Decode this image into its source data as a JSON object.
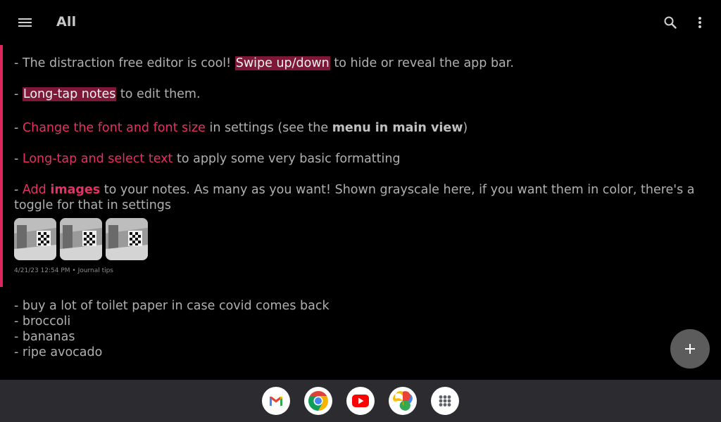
{
  "app_bar": {
    "title": "All",
    "menu_icon": "menu-icon",
    "search_icon": "search-icon",
    "more_icon": "more-vert-icon"
  },
  "note1": {
    "accent_color": "#e0245e",
    "line1": {
      "prefix": "- The distraction free editor is cool! ",
      "highlight": "Swipe up/down",
      "suffix": " to hide or reveal the app bar."
    },
    "line2": {
      "prefix": "- ",
      "highlight": "Long-tap notes",
      "suffix": " to edit them."
    },
    "line3": {
      "prefix": "- ",
      "link": "Change the font and font size",
      "middle": " in settings (see the ",
      "bold": "menu in main view",
      "suffix": ")"
    },
    "line4": {
      "prefix": "- ",
      "link": "Long-tap and select text",
      "suffix": " to apply some very basic formatting"
    },
    "line5": {
      "prefix": "- ",
      "link": "Add ",
      "link_bold": "images",
      "suffix": " to your notes. As many as you want! Shown grayscale here, if you want them in color, there's a"
    },
    "line6": "toggle for that in settings",
    "images": [
      "image-thumbnail",
      "image-thumbnail",
      "image-thumbnail"
    ],
    "meta": {
      "date": "4/21/23 12:54 PM",
      "separator": " • ",
      "tag": "Journal tips"
    }
  },
  "note2": {
    "lines": [
      "- buy a lot of toilet paper in case covid comes back",
      "- broccoli",
      "- bananas",
      "- ripe avocado"
    ]
  },
  "fab": {
    "icon": "plus-icon"
  },
  "taskbar": {
    "apps": [
      "gmail-icon",
      "chrome-icon",
      "youtube-icon",
      "photos-icon",
      "app-drawer-icon"
    ]
  }
}
